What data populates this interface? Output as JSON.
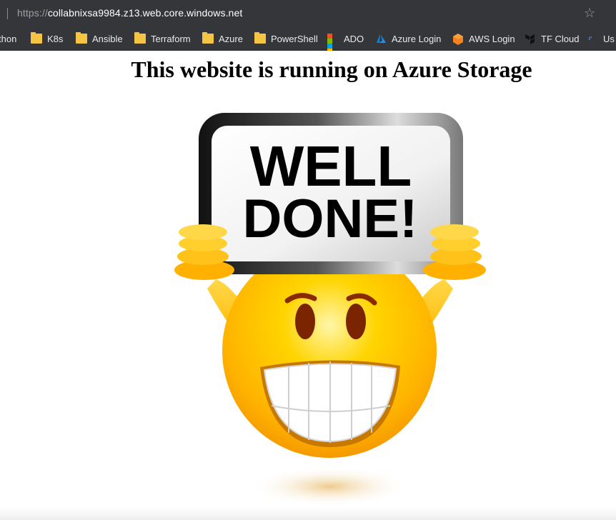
{
  "browser": {
    "url_scheme": "https://",
    "url_host": "collabnixsa9984.z13.web.core.windows.net"
  },
  "bookmarks": [
    {
      "label": "thon",
      "icon": "folder-icon"
    },
    {
      "label": "K8s",
      "icon": "folder-icon"
    },
    {
      "label": "Ansible",
      "icon": "folder-icon"
    },
    {
      "label": "Terraform",
      "icon": "folder-icon"
    },
    {
      "label": "Azure",
      "icon": "folder-icon"
    },
    {
      "label": "PowerShell",
      "icon": "folder-icon"
    },
    {
      "label": "ADO",
      "icon": "microsoft-icon"
    },
    {
      "label": "Azure Login",
      "icon": "azure-icon"
    },
    {
      "label": "AWS Login",
      "icon": "aws-icon"
    },
    {
      "label": "TF Cloud",
      "icon": "terraform-icon"
    },
    {
      "label": "Us",
      "icon": "link-icon"
    }
  ],
  "page": {
    "heading": "This website is running on Azure Storage",
    "sign_line1": "WELL",
    "sign_line2": "DONE!"
  },
  "colors": {
    "chrome_bg": "#35363a",
    "smiley_yellow": "#ffcc00",
    "folder_yellow": "#f5c445"
  }
}
